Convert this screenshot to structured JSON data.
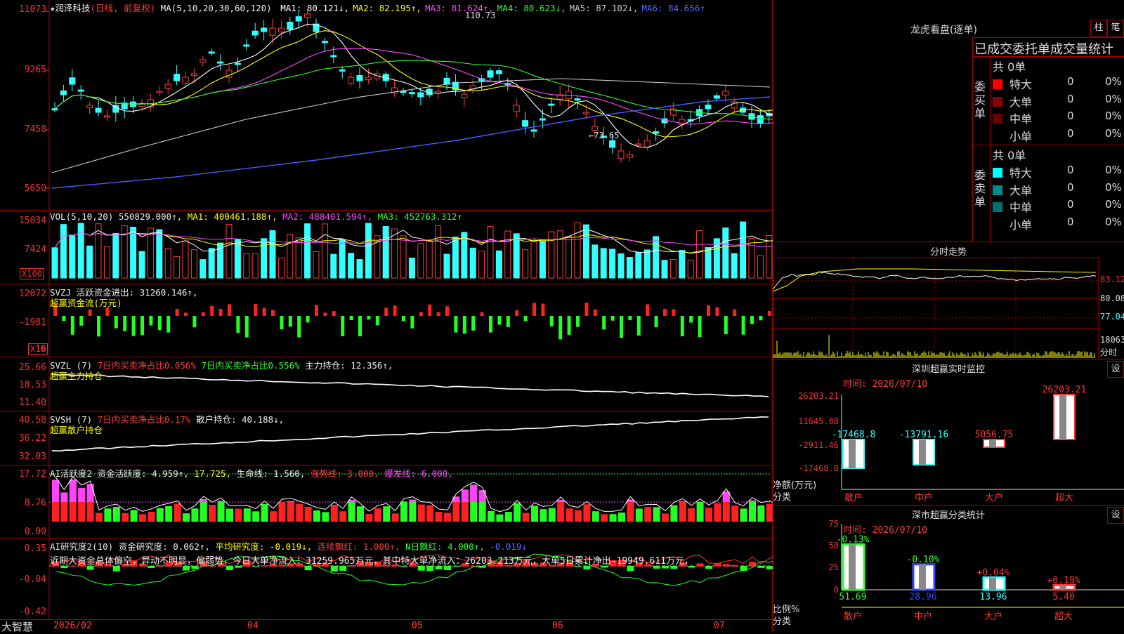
{
  "stock": {
    "name": "★润泽科技",
    "period": "(日线, 前复权)"
  },
  "main_chart": {
    "ma_header": "MA(5,10,20,30,60,120)",
    "ma": [
      {
        "label": "MA1: 80.121↓,",
        "color": "#ffffff"
      },
      {
        "label": "MA2: 82.195↑,",
        "color": "#ffff00"
      },
      {
        "label": "MA3: 81.624↑,",
        "color": "#ff44ff"
      },
      {
        "label": "MA4: 80.623↓,",
        "color": "#2eff2e"
      },
      {
        "label": "MA5: 87.102↓,",
        "color": "#cccccc"
      },
      {
        "label": "MA6: 84.656↑",
        "color": "#5a6bff"
      }
    ],
    "y_ticks": [
      "11073",
      "9265",
      "7458",
      "5650"
    ],
    "high_label": "110.73",
    "low_label": "←73.65"
  },
  "vol": {
    "header": "VOL(5,10,20)",
    "value": "550829.000↑,",
    "ma1": "MA1: 400461.188↑,",
    "ma2": "MA2: 488401.594↑,",
    "ma3": "MA3: 452763.312↑",
    "y_ticks": [
      "15034",
      "7424"
    ],
    "unit": "X100"
  },
  "svzj": {
    "header": "SVZJ  活跃资金进出: 31260.146↑,",
    "sub": "超赢资金流(万元)",
    "y_ticks": [
      "12072",
      "-1981",
      "-16"
    ],
    "unit": "X10"
  },
  "svzl": {
    "header": "SVZL (7)",
    "t1": "7日内买卖净占比0.056%",
    "t2": "7日内买卖净占比0.556%",
    "t3": "主力持仓: 12.356↑,",
    "sub": "超赢主力持仓",
    "y_ticks": [
      "25.66",
      "18.53",
      "11.40"
    ]
  },
  "svsh": {
    "header": "SVSH (7)",
    "t1": "7日内买卖净占比0.17%",
    "t2": "散户持仓: 40.188↓,",
    "sub": "超赢散户持仓",
    "y_ticks": [
      "40.58",
      "36.22",
      "32.03"
    ]
  },
  "ai_active": {
    "header": "AI活跃度2 资金活跃度: 4.959↑,",
    "v2": "17.725,",
    "v3": "生命线: 1.560,",
    "v4": "强势线: 3.000,",
    "v5": "爆发线: 6.000,",
    "y_ticks": [
      "17.72",
      "8.76",
      "0.00"
    ]
  },
  "ai_research": {
    "header": "AI研究度2(10) 资金研究度: 0.062↑,",
    "v2": "平均研究度: -0.019↓,",
    "v3": "连续飘红: 1.000↑,",
    "v4": "N日飘红: 4.000↑,",
    "v5": "-0.019↓",
    "comment": "近期大资金总体偏空，异动不明显，偏弱势，今日大单净流入：31259.965万元，其中特大单净流入：26203.213万元，大单5日累计净出-19949.611万元，",
    "y_ticks": [
      "0.35",
      "-0.04",
      "-0.42"
    ]
  },
  "bottom": {
    "app": "大智慧",
    "dates": [
      "2026/02",
      "04",
      "05",
      "06",
      "07"
    ]
  },
  "longhu": {
    "title": "龙虎看盘(逐单)",
    "btn1": "柱",
    "btn2": "笔",
    "subtitle": "已成交委托单成交量统计",
    "buy": {
      "label": "委买单",
      "count": "共 0单",
      "rows": [
        {
          "name": "特大",
          "v": "0",
          "p": "0%",
          "c": "#ff0000"
        },
        {
          "name": "大单",
          "v": "0",
          "p": "0%",
          "c": "#8b0000"
        },
        {
          "name": "中单",
          "v": "0",
          "p": "0%",
          "c": "#6b0000"
        },
        {
          "name": "小单",
          "v": "0",
          "p": "0%",
          "c": "#000000"
        }
      ]
    },
    "sell": {
      "label": "委卖单",
      "count": "共 0单",
      "rows": [
        {
          "name": "特大",
          "v": "0",
          "p": "0%",
          "c": "#00ffff"
        },
        {
          "name": "大单",
          "v": "0",
          "p": "0%",
          "c": "#008b8b"
        },
        {
          "name": "中单",
          "v": "0",
          "p": "0%",
          "c": "#007070"
        },
        {
          "name": "小单",
          "v": "0",
          "p": "0%",
          "c": "#000000"
        }
      ]
    }
  },
  "intraday": {
    "title": "分时走势",
    "price_labels": [
      "83.12",
      "80.08",
      "77.04"
    ],
    "vol_label": "18063",
    "vol_unit": "分时"
  },
  "sz_monitor": {
    "title": "深圳超赢实时监控",
    "settings": "设",
    "time": "时间: 2026/07/10",
    "y_ticks": [
      "26203.21",
      "11645.88",
      "-2911.46",
      "-17468.8"
    ],
    "ylabel": "净额(万元)",
    "xlabel": "分类",
    "bars": [
      {
        "cat": "散户",
        "v": "-17468.8"
      },
      {
        "cat": "中户",
        "v": "-13791.16"
      },
      {
        "cat": "大户",
        "v": "5056.75"
      },
      {
        "cat": "超大",
        "v": "26203.21"
      }
    ]
  },
  "sz_class": {
    "title": "深市超赢分类统计",
    "settings": "设",
    "time": "时间: 2026/07/10",
    "y_ticks": [
      "75",
      "50",
      "25",
      "0"
    ],
    "ylabel": "比例%",
    "xlabel": "分类",
    "bars": [
      {
        "cat": "散户",
        "pct": "-0.13%",
        "v": "51.69"
      },
      {
        "cat": "中户",
        "pct": "-0.10%",
        "v": "28.96"
      },
      {
        "cat": "大户",
        "pct": "+0.04%",
        "v": "13.96"
      },
      {
        "cat": "超大",
        "pct": "+0.19%",
        "v": "5.40"
      }
    ]
  }
}
